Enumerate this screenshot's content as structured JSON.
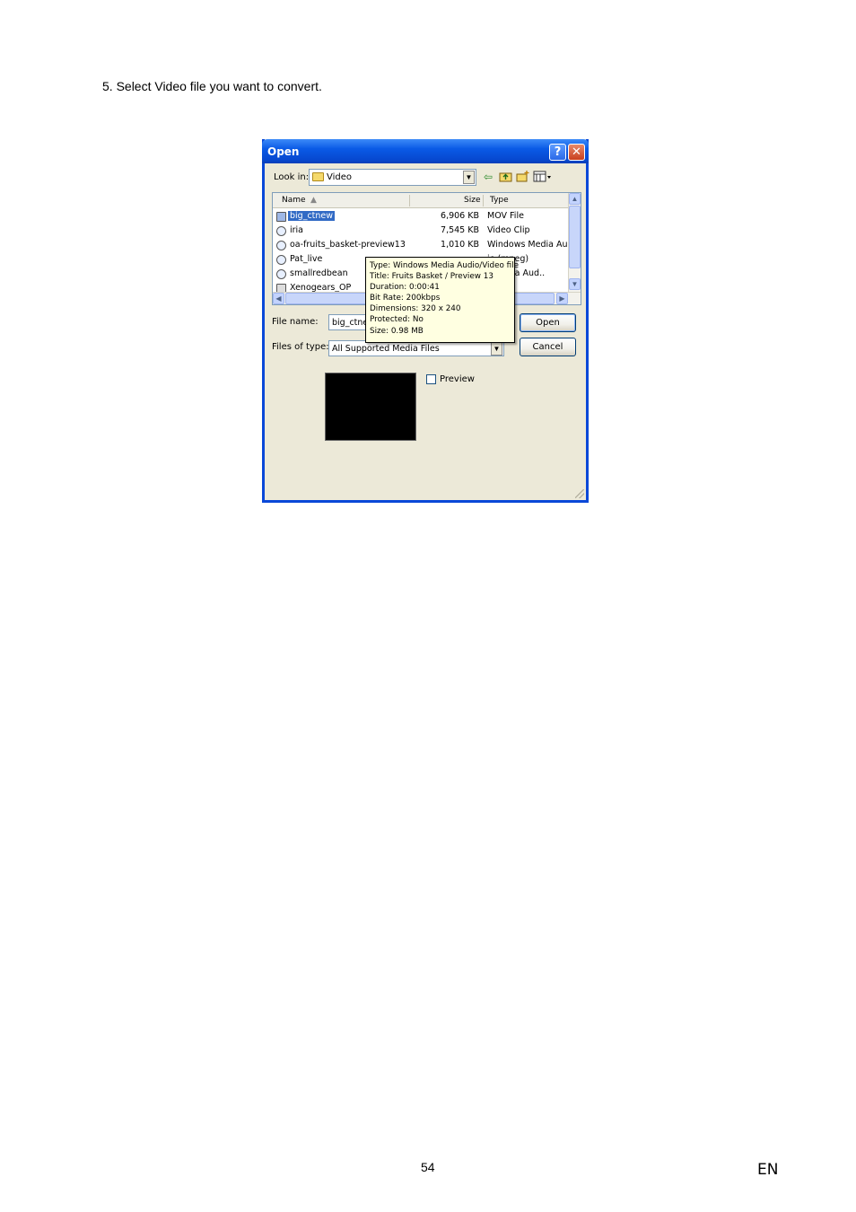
{
  "document": {
    "instruction": "5. Select Video file you want to convert.",
    "page_number": "54",
    "language": "EN"
  },
  "dialog": {
    "title": "Open",
    "help_label": "?",
    "close_label": "✕",
    "look_in_label": "Look in:",
    "look_in_value": "Video",
    "toolbar_icons": [
      "back-icon",
      "up-folder-icon",
      "new-folder-icon",
      "view-menu-icon"
    ],
    "columns": {
      "name": "Name",
      "size": "Size",
      "type": "Type"
    },
    "files": [
      {
        "name": "big_ctnew",
        "size": "6,906 KB",
        "type": "MOV File",
        "selected": true
      },
      {
        "name": "iria",
        "size": "7,545 KB",
        "type": "Video Clip",
        "selected": false
      },
      {
        "name": "oa-fruits_basket-preview13",
        "size": "1,010 KB",
        "type": "Windows Media Aud..",
        "selected": false
      },
      {
        "name": "Pat_live",
        "size": "",
        "type": "ie (mpeg)",
        "selected": false
      },
      {
        "name": "smallredbean",
        "size": "",
        "type": "s Media Aud..",
        "selected": false
      },
      {
        "name": "Xenogears_OP",
        "size": "",
        "type": "",
        "selected": false
      }
    ],
    "tooltip": {
      "lines": [
        "Type: Windows Media Audio/Video file",
        "Title: Fruits Basket / Preview 13",
        "Duration: 0:00:41",
        "Bit Rate: 200kbps",
        "Dimensions: 320 x 240",
        "Protected: No",
        "Size: 0.98 MB"
      ]
    },
    "file_name_label": "File name:",
    "file_name_value": "big_ctnew",
    "files_of_type_label": "Files of type:",
    "files_of_type_value": "All Supported Media Files",
    "open_button": "Open",
    "cancel_button": "Cancel",
    "preview_label": "Preview",
    "preview_checked": false
  }
}
